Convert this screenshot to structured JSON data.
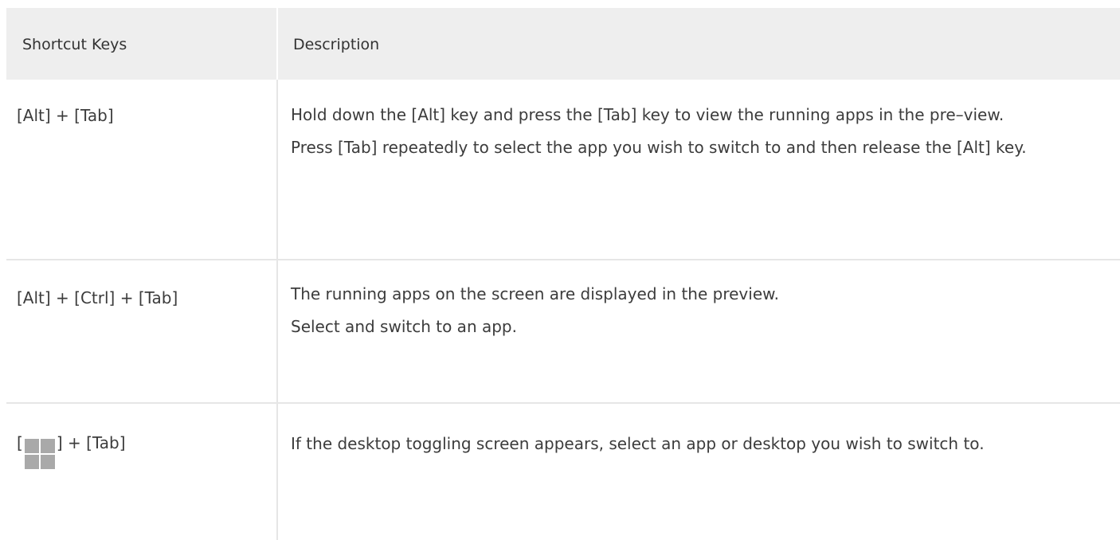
{
  "table": {
    "headers": {
      "keys": "Shortcut Keys",
      "description": "Description"
    },
    "rows": [
      {
        "keys": "[Alt] + [Tab]",
        "description": [
          "Hold down the [Alt] key and press the [Tab] key to view the running apps in the pre–view.",
          "Press [Tab] repeatedly to select the app you wish to switch to and then release the [Alt] key."
        ]
      },
      {
        "keys": "[Alt] + [Ctrl] + [Tab]",
        "description": [
          "The running apps on the screen are displayed in the preview.",
          "Select and switch to an app."
        ]
      },
      {
        "keys_prefix": "[",
        "keys_icon": "windows-logo-icon",
        "keys_suffix": "] + [Tab]",
        "description": [
          "If the desktop toggling screen appears, select an app or desktop you wish to switch to."
        ]
      }
    ]
  }
}
